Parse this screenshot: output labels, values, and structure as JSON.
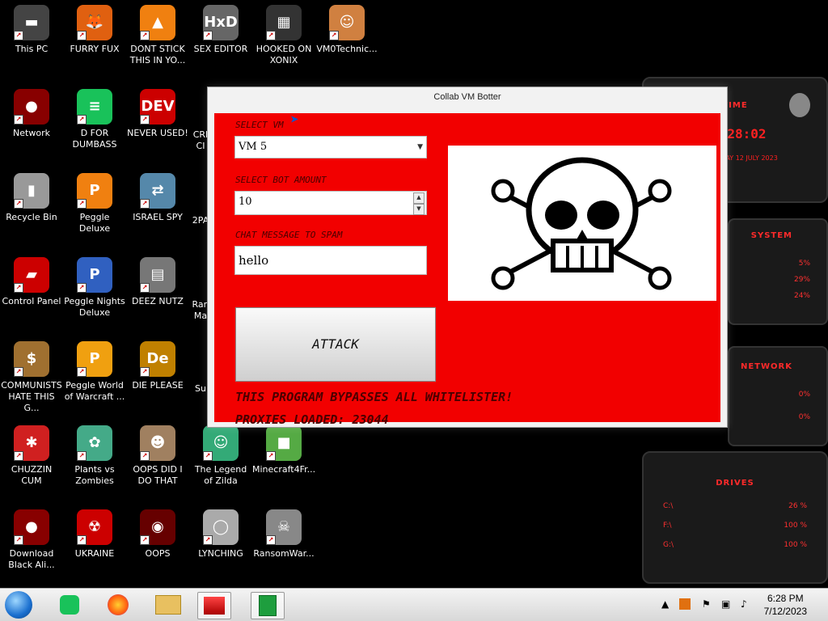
{
  "desktop": {
    "icons": [
      {
        "label": "This PC",
        "glyph": "▬",
        "color": "#444"
      },
      {
        "label": "FURRY FUX",
        "glyph": "🦊",
        "color": "#e06010"
      },
      {
        "label": "DONT STICK THIS IN YO...",
        "glyph": "▲",
        "color": "#f08010"
      },
      {
        "label": "SEX EDITOR",
        "glyph": "HxD",
        "color": "#666"
      },
      {
        "label": "HOOKED ON XONIX",
        "glyph": "▦",
        "color": "#333"
      },
      {
        "label": "VM0Technic...",
        "glyph": "☺",
        "color": "#d08040"
      },
      {
        "label": "Network",
        "glyph": "●",
        "color": "#800"
      },
      {
        "label": "D FOR DUMBASS",
        "glyph": "≡",
        "color": "#19c25a"
      },
      {
        "label": "NEVER USED!",
        "glyph": "DEV",
        "color": "#c00"
      },
      {
        "label": "Recycle Bin",
        "glyph": "▮",
        "color": "#999"
      },
      {
        "label": "Peggle Deluxe",
        "glyph": "P",
        "color": "#f08010"
      },
      {
        "label": "ISRAEL SPY",
        "glyph": "⇄",
        "color": "#58a"
      },
      {
        "label": "Control Panel",
        "glyph": "▰",
        "color": "#c00"
      },
      {
        "label": "Peggle Nights Deluxe",
        "glyph": "P",
        "color": "#3060c0"
      },
      {
        "label": "DEEZ NUTZ",
        "glyph": "▤",
        "color": "#777"
      },
      {
        "label": "COMMUNISTS HATE THIS G...",
        "glyph": "$",
        "color": "#a07030"
      },
      {
        "label": "Peggle World of Warcraft ...",
        "glyph": "P",
        "color": "#f0a010"
      },
      {
        "label": "DIE PLEASE",
        "glyph": "De",
        "color": "#c08000"
      },
      {
        "label": "CHUZZIN CUM",
        "glyph": "✱",
        "color": "#d02020"
      },
      {
        "label": "Plants vs Zombies",
        "glyph": "✿",
        "color": "#4a8"
      },
      {
        "label": "OOPS DID I DO THAT",
        "glyph": "☻",
        "color": "#a08060"
      },
      {
        "label": "The Legend of Zilda",
        "glyph": "☺",
        "color": "#3a7"
      },
      {
        "label": "Minecraft4Fr...",
        "glyph": "■",
        "color": "#5a4"
      },
      {
        "label": "Download Black Ali...",
        "glyph": "●",
        "color": "#800"
      },
      {
        "label": "UKRAINE",
        "glyph": "☢",
        "color": "#c00"
      },
      {
        "label": "OOPS",
        "glyph": "◉",
        "color": "#600"
      },
      {
        "label": "LYNCHING",
        "glyph": "◯",
        "color": "#aaa"
      },
      {
        "label": "RansomWar...",
        "glyph": "☠",
        "color": "#888"
      }
    ],
    "partial_labels": [
      "CRI",
      "CI",
      "2PA",
      "Ran",
      "Ma",
      "Su"
    ]
  },
  "window": {
    "title": "Collab VM Botter",
    "select_vm_label": "SELECT VM",
    "vm_value": "VM 5",
    "bot_amount_label": "SELECT BOT AMOUNT",
    "bot_amount_value": "10",
    "chat_label": "CHAT MESSAGE TO SPAM",
    "chat_value": "hello",
    "attack_label": "ATTACK",
    "bypass_text": "THIS PROGRAM BYPASSES ALL WHITELISTER!",
    "proxies_text": "PROXIES LOADED: 23044",
    "accent": "#f20000"
  },
  "gadget": {
    "time_title": "TIME",
    "time_value": "18:28:02",
    "date_value": "WEDNESDAY 12 JULY 2023",
    "system_title": "SYSTEM",
    "system_values": [
      "5%",
      "29%",
      "24%"
    ],
    "network_title": "NETWORK",
    "network_values": [
      "0%",
      "0%"
    ],
    "drives_title": "DRIVES",
    "drives": [
      {
        "name": "C:\\",
        "value": "26 %"
      },
      {
        "name": "F:\\",
        "value": "100 %"
      },
      {
        "name": "G:\\",
        "value": "100 %"
      }
    ]
  },
  "taskbar": {
    "time": "6:28 PM",
    "date": "7/12/2023"
  }
}
